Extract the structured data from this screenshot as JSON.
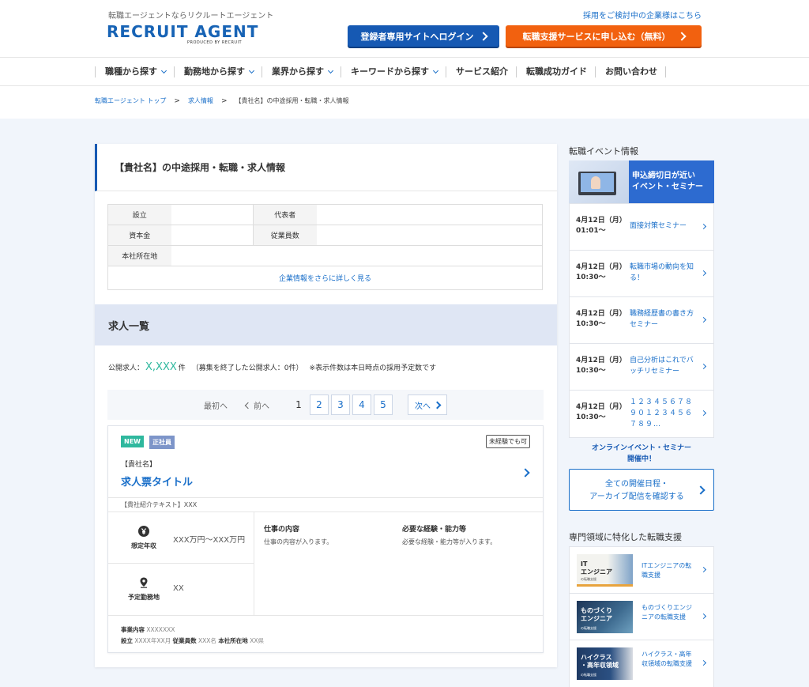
{
  "header": {
    "tagline": "転職エージェントならリクルートエージェント",
    "logo": "RECRUIT AGENT",
    "logo_sub": "PRODUCED BY RECRUIT",
    "corporate_link": "採用をご検討中の企業様はこちら",
    "member_button": "登録者専用サイトへログイン",
    "apply_button": "転職支援サービスに申し込む（無料）"
  },
  "nav": {
    "items": [
      {
        "label": "職種から探す",
        "dropdown": true
      },
      {
        "label": "勤務地から探す",
        "dropdown": true
      },
      {
        "label": "業界から探す",
        "dropdown": true
      },
      {
        "label": "キーワードから探す",
        "dropdown": true
      },
      {
        "label": "サービス紹介",
        "dropdown": false
      },
      {
        "label": "転職成功ガイド",
        "dropdown": false
      },
      {
        "label": "お問い合わせ",
        "dropdown": false
      }
    ]
  },
  "breadcrumb": {
    "top": "転職エージェント トップ",
    "jobs": "求人情報",
    "current": "【貴社名】の中途採用・転職・求人情報"
  },
  "company": {
    "title": "【貴社名】の中途採用・転職・求人情報",
    "labels": {
      "founded": "設立",
      "representative": "代表者",
      "capital": "資本金",
      "employees": "従業員数",
      "address": "本社所在地"
    },
    "more_link": "企業情報をさらに詳しく見る"
  },
  "joblist": {
    "heading": "求人一覧",
    "public_label": "公開求人：",
    "public_count": "X,XXX",
    "public_unit": "件",
    "closed_note": "（募集を終了した公開求人：0件）",
    "note": "※表示件数は本日時点の採用予定数です"
  },
  "pager": {
    "first": "最初へ",
    "prev": "前へ",
    "current": "1",
    "pages": [
      "2",
      "3",
      "4",
      "5"
    ],
    "next": "次へ"
  },
  "job": {
    "badge_new": "NEW",
    "badge_type": "正社員",
    "badge_noexp": "未経験でも可",
    "company": "【貴社名】",
    "title": "求人票タイトル",
    "intro": "【貴社紹介テキスト】XXX",
    "salary_label": "想定年収",
    "salary_value": "XXX万円〜XXX万円",
    "location_label": "予定勤務地",
    "location_value": "XX",
    "work_heading": "仕事の内容",
    "work_text": "仕事の内容が入ります。",
    "req_heading": "必要な経験・能力等",
    "req_text": "必要な経験・能力等が入ります。",
    "foot": {
      "business_label": "事業内容",
      "business_value": "XXXXXXX",
      "founded_label": "設立",
      "founded_value": "XXXX年XX月",
      "employees_label": "従業員数",
      "employees_value": "XXX名",
      "address_label": "本社所在地",
      "address_value": "XX県"
    }
  },
  "sidebar": {
    "events_heading": "転職イベント情報",
    "banner_line1": "申込締切日が近い",
    "banner_line2": "イベント・セミナー",
    "events": [
      {
        "date1": "4月12日（月）",
        "date2": "01:01〜",
        "name": "面接対策セミナー"
      },
      {
        "date1": "4月12日（月）",
        "date2": "10:30〜",
        "name": "転職市場の動向を知る！"
      },
      {
        "date1": "4月12日（月）",
        "date2": "10:30〜",
        "name": "職務経歴書の書き方セミナー"
      },
      {
        "date1": "4月12日（月）",
        "date2": "10:30〜",
        "name": "自己分析はこれでバッチリセミナー"
      },
      {
        "date1": "4月12日（月）",
        "date2": "10:30〜",
        "name": "１２３４５６７８９０１２３４５６７８９…"
      }
    ],
    "online_line1": "オンラインイベント・セミナー",
    "online_line2": "開催中！",
    "archive_line1": "全ての開催日程・",
    "archive_line2": "アーカイブ配信を確認する",
    "support_heading": "専門領域に特化した転職支援",
    "support": [
      {
        "tag1": "IT",
        "tag2": "エンジニア",
        "small": "の転職支援",
        "name": "ITエンジニアの転職支援"
      },
      {
        "tag1": "ものづくり",
        "tag2": "エンジニア",
        "small": "の転職支援",
        "name": "ものづくりエンジニアの転職支援"
      },
      {
        "tag1": "ハイクラス",
        "tag2": "・高年収領域",
        "small": "の転職支援",
        "name": "ハイクラス・高年収領域の転職支援"
      }
    ]
  }
}
